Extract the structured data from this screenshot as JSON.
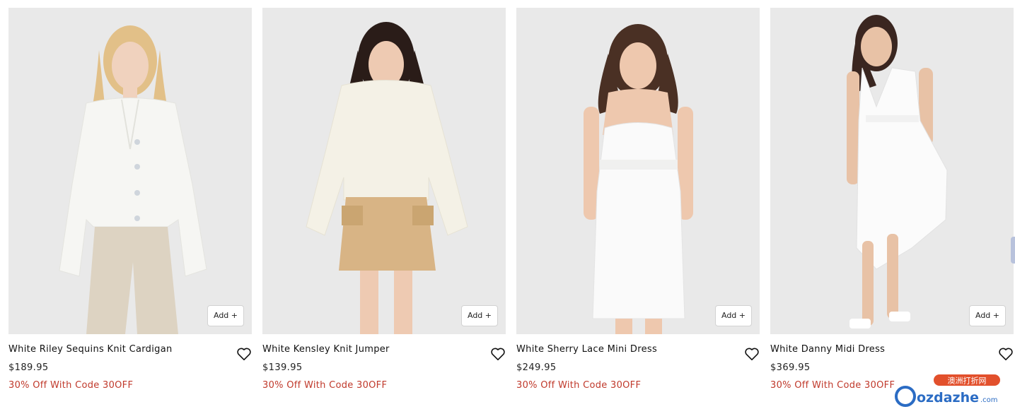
{
  "products": [
    {
      "name": "White Riley Sequins Knit Cardigan",
      "price": "$189.95",
      "promo": "30% Off With Code 30OFF",
      "add_label": "Add +",
      "hair_color": "#e2c088",
      "top_color": "#f6f6f3",
      "bottom_color": "#ddd3c2",
      "skin_color": "#f0d2be"
    },
    {
      "name": "White Kensley Knit Jumper",
      "price": "$139.95",
      "promo": "30% Off With Code 30OFF",
      "add_label": "Add +",
      "hair_color": "#2a1c18",
      "top_color": "#f4f1e6",
      "bottom_color": "#d8b485",
      "skin_color": "#eecab2"
    },
    {
      "name": "White Sherry Lace Mini Dress",
      "price": "$249.95",
      "promo": "30% Off With Code 30OFF",
      "add_label": "Add +",
      "hair_color": "#4a3024",
      "top_color": "#fafafa",
      "bottom_color": "#fafafa",
      "skin_color": "#eec8ae"
    },
    {
      "name": "White Danny Midi Dress",
      "price": "$369.95",
      "promo": "30% Off With Code 30OFF",
      "add_label": "Add +",
      "hair_color": "#3a2620",
      "top_color": "#fbfbfb",
      "bottom_color": "#fbfbfb",
      "skin_color": "#e8c2a6"
    }
  ],
  "colors": {
    "photo_background": "#e9e9e9",
    "promo_text": "#c0392b",
    "text_primary": "#111111"
  },
  "watermark": {
    "text_cn": "澳洲打折网",
    "text_en": "ozdazhe",
    "text_com": ".com"
  },
  "icons": {
    "wishlist": "heart-icon"
  }
}
